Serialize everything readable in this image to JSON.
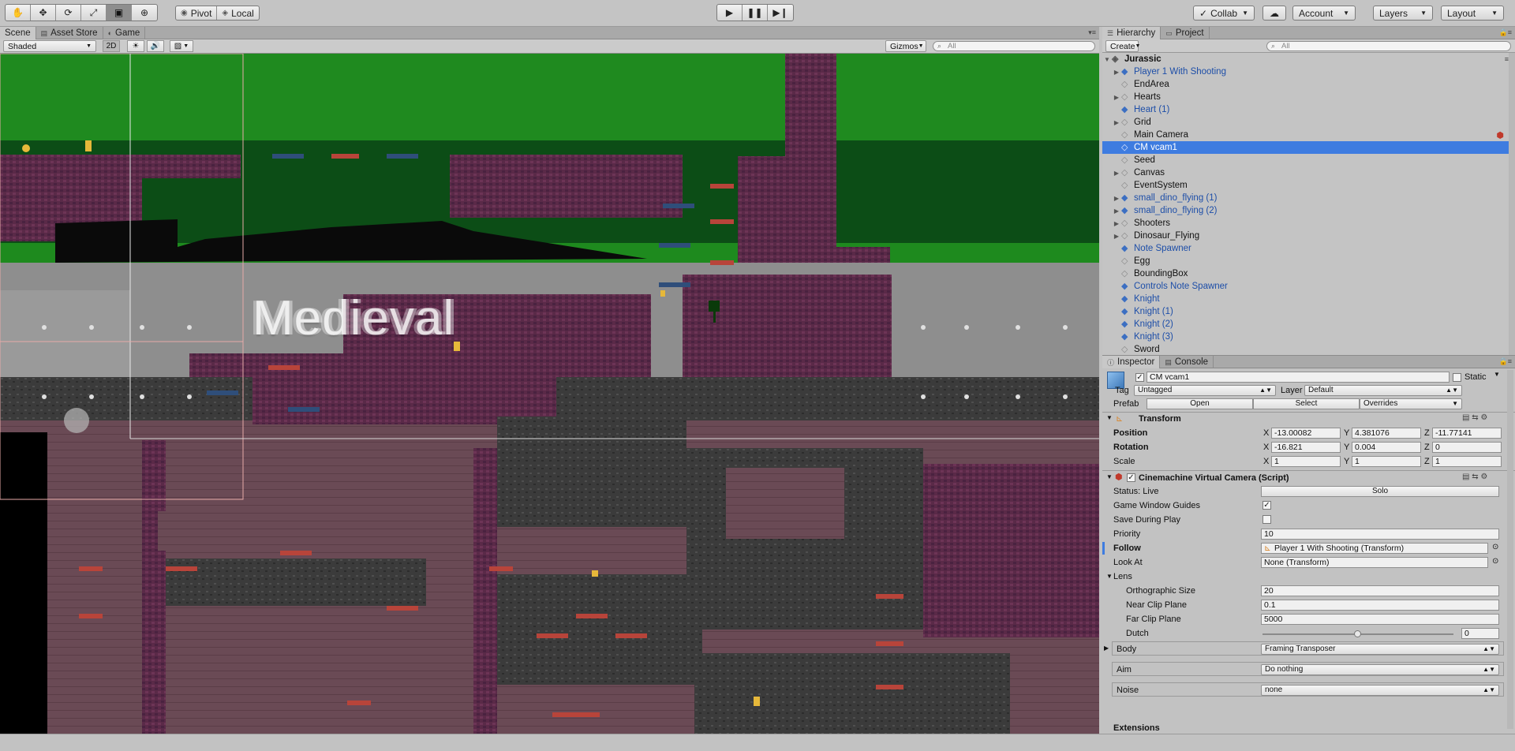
{
  "toolbar": {
    "tools": [
      "hand-tool",
      "move-tool",
      "rotate-tool",
      "scale-tool",
      "rect-tool",
      "transform-tool"
    ],
    "pivot_label": "Pivot",
    "local_label": "Local",
    "play_controls": [
      "play",
      "pause",
      "step"
    ],
    "collab_label": "Collab",
    "account_label": "Account",
    "layers_label": "Layers",
    "layout_label": "Layout"
  },
  "scene_tabs": [
    {
      "label": "Scene"
    },
    {
      "label": "Asset Store"
    },
    {
      "label": "Game"
    }
  ],
  "scene_toolbar": {
    "shading_mode": "Shaded",
    "mode_2d": "2D",
    "gizmos_label": "Gizmos",
    "search_placeholder": "All"
  },
  "viewport": {
    "overlay_text": "Medieval"
  },
  "hierarchy": {
    "tabs": [
      {
        "label": "Hierarchy"
      },
      {
        "label": "Project"
      }
    ],
    "create_label": "Create",
    "search_placeholder": "All",
    "scene_name": "Jurassic",
    "items": [
      {
        "label": "Player 1 With Shooting",
        "prefab": true,
        "foldout": true,
        "arrow": true
      },
      {
        "label": "EndArea",
        "prefab": false,
        "foldout": false,
        "arrow": false
      },
      {
        "label": "Hearts",
        "prefab": false,
        "foldout": true,
        "arrow": false
      },
      {
        "label": "Heart (1)",
        "prefab": true,
        "foldout": false,
        "arrow": true
      },
      {
        "label": "Grid",
        "prefab": false,
        "foldout": true,
        "arrow": false
      },
      {
        "label": "Main Camera",
        "prefab": false,
        "foldout": false,
        "arrow": false
      },
      {
        "label": "CM vcam1",
        "prefab": false,
        "foldout": false,
        "arrow": true,
        "selected": true
      },
      {
        "label": "Seed",
        "prefab": false,
        "foldout": false,
        "arrow": false
      },
      {
        "label": "Canvas",
        "prefab": false,
        "foldout": true,
        "arrow": false
      },
      {
        "label": "EventSystem",
        "prefab": false,
        "foldout": false,
        "arrow": false
      },
      {
        "label": "small_dino_flying (1)",
        "prefab": true,
        "foldout": true,
        "arrow": true
      },
      {
        "label": "small_dino_flying (2)",
        "prefab": true,
        "foldout": true,
        "arrow": true
      },
      {
        "label": "Shooters",
        "prefab": false,
        "foldout": true,
        "arrow": false
      },
      {
        "label": "Dinosaur_Flying",
        "prefab": false,
        "foldout": true,
        "arrow": false
      },
      {
        "label": "Note Spawner",
        "prefab": true,
        "foldout": false,
        "arrow": true
      },
      {
        "label": "Egg",
        "prefab": false,
        "foldout": false,
        "arrow": false
      },
      {
        "label": "BoundingBox",
        "prefab": false,
        "foldout": false,
        "arrow": false
      },
      {
        "label": "Controls Note Spawner",
        "prefab": true,
        "foldout": false,
        "arrow": true
      },
      {
        "label": "Knight",
        "prefab": true,
        "foldout": false,
        "arrow": true
      },
      {
        "label": "Knight (1)",
        "prefab": true,
        "foldout": false,
        "arrow": true
      },
      {
        "label": "Knight (2)",
        "prefab": true,
        "foldout": false,
        "arrow": true
      },
      {
        "label": "Knight (3)",
        "prefab": true,
        "foldout": false,
        "arrow": true
      },
      {
        "label": "Sword",
        "prefab": false,
        "foldout": false,
        "arrow": false
      }
    ]
  },
  "inspector": {
    "tabs": [
      {
        "label": "Inspector"
      },
      {
        "label": "Console"
      }
    ],
    "object_name": "CM vcam1",
    "static_label": "Static",
    "tag_label": "Tag",
    "tag_value": "Untagged",
    "layer_label": "Layer",
    "layer_value": "Default",
    "prefab_label": "Prefab",
    "prefab_open": "Open",
    "prefab_select": "Select",
    "prefab_overrides": "Overrides",
    "transform": {
      "title": "Transform",
      "position_label": "Position",
      "rotation_label": "Rotation",
      "scale_label": "Scale",
      "position": {
        "x": "-13.00082",
        "y": "4.381076",
        "z": "-11.77141"
      },
      "rotation": {
        "x": "-16.821",
        "y": "0.004",
        "z": "0"
      },
      "scale": {
        "x": "1",
        "y": "1",
        "z": "1"
      }
    },
    "vcam": {
      "title": "Cinemachine Virtual Camera (Script)",
      "status_label": "Status: Live",
      "solo_label": "Solo",
      "game_window_guides_label": "Game Window Guides",
      "game_window_guides_checked": true,
      "save_during_play_label": "Save During Play",
      "save_during_play_checked": false,
      "priority_label": "Priority",
      "priority_value": "10",
      "follow_label": "Follow",
      "follow_value": "Player 1 With Shooting (Transform)",
      "look_at_label": "Look At",
      "look_at_value": "None (Transform)",
      "lens_label": "Lens",
      "ortho_label": "Orthographic Size",
      "ortho_value": "20",
      "near_label": "Near Clip Plane",
      "near_value": "0.1",
      "far_label": "Far Clip Plane",
      "far_value": "5000",
      "dutch_label": "Dutch",
      "dutch_value": "0",
      "dutch_fraction": 0.5,
      "body_label": "Body",
      "body_value": "Framing Transposer",
      "aim_label": "Aim",
      "aim_value": "Do nothing",
      "noise_label": "Noise",
      "noise_value": "none",
      "extensions_label": "Extensions"
    }
  },
  "colors": {
    "accent_selected": "#3e7ce0",
    "prefab_text": "#1d4ea8"
  }
}
